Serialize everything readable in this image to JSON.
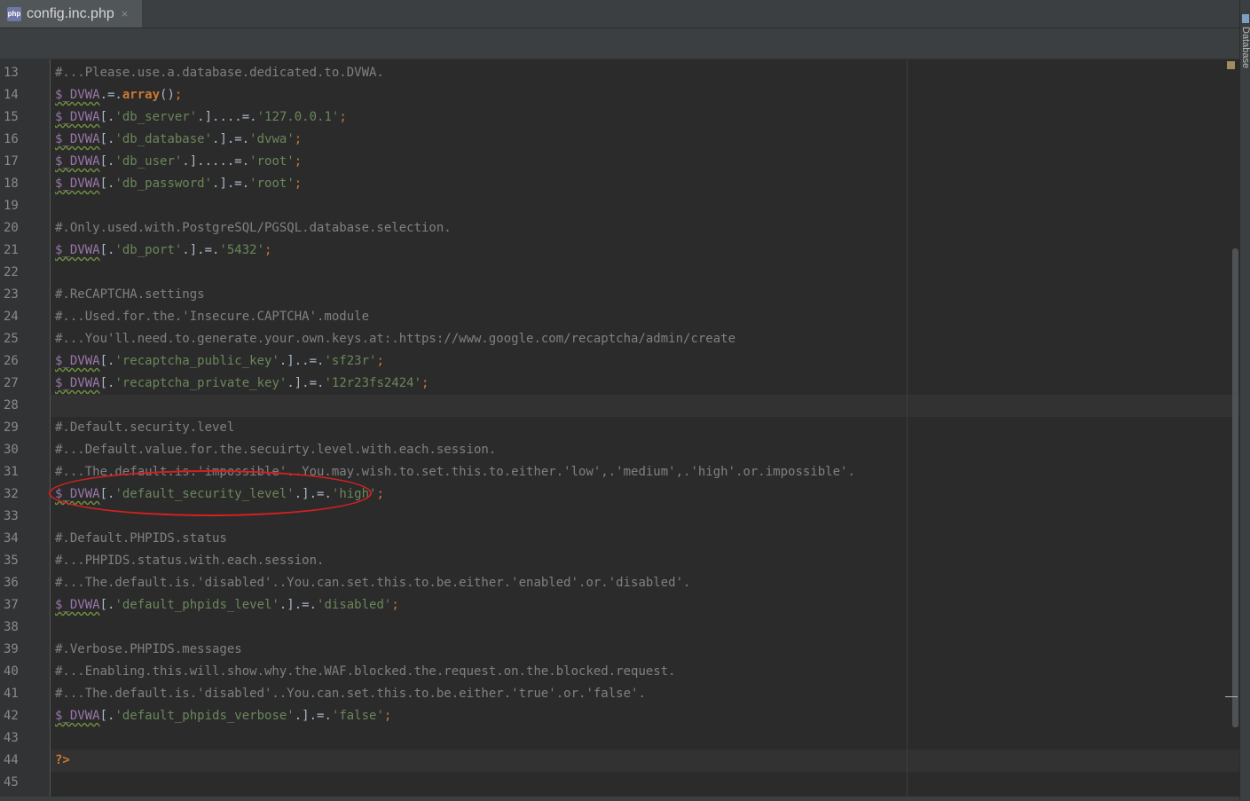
{
  "tab": {
    "icon": "php-file-icon",
    "icon_text": "php",
    "label": "config.inc.php",
    "close": "×"
  },
  "side_panel": {
    "label": "Database"
  },
  "colors": {
    "comment": "#808080",
    "variable": "#9876aa",
    "string": "#6a8759",
    "keyword": "#cc7832",
    "text": "#a9b7c6",
    "annotation": "#d42020"
  },
  "lines": [
    {
      "n": "13",
      "tokens": [
        {
          "t": "#...Please.use.a.database.dedicated.to.DVWA.",
          "c": "comment"
        }
      ]
    },
    {
      "n": "14",
      "tokens": [
        {
          "t": "$_DVWA",
          "c": "var"
        },
        {
          "t": ".=.",
          "c": "plain"
        },
        {
          "t": "array",
          "c": "kw"
        },
        {
          "t": "()",
          "c": "plain"
        },
        {
          "t": ";",
          "c": "punc"
        }
      ]
    },
    {
      "n": "15",
      "tokens": [
        {
          "t": "$_DVWA",
          "c": "var"
        },
        {
          "t": "[.",
          "c": "plain"
        },
        {
          "t": "'db_server'",
          "c": "str"
        },
        {
          "t": ".]....=.",
          "c": "plain"
        },
        {
          "t": "'127.0.0.1'",
          "c": "str"
        },
        {
          "t": ";",
          "c": "punc"
        }
      ]
    },
    {
      "n": "16",
      "tokens": [
        {
          "t": "$_DVWA",
          "c": "var"
        },
        {
          "t": "[.",
          "c": "plain"
        },
        {
          "t": "'db_database'",
          "c": "str"
        },
        {
          "t": ".].=.",
          "c": "plain"
        },
        {
          "t": "'dvwa'",
          "c": "str"
        },
        {
          "t": ";",
          "c": "punc"
        }
      ]
    },
    {
      "n": "17",
      "tokens": [
        {
          "t": "$_DVWA",
          "c": "var"
        },
        {
          "t": "[.",
          "c": "plain"
        },
        {
          "t": "'db_user'",
          "c": "str"
        },
        {
          "t": ".].....=.",
          "c": "plain"
        },
        {
          "t": "'root'",
          "c": "str"
        },
        {
          "t": ";",
          "c": "punc"
        }
      ]
    },
    {
      "n": "18",
      "tokens": [
        {
          "t": "$_DVWA",
          "c": "var"
        },
        {
          "t": "[.",
          "c": "plain"
        },
        {
          "t": "'db_password'",
          "c": "str"
        },
        {
          "t": ".].=.",
          "c": "plain"
        },
        {
          "t": "'root'",
          "c": "str"
        },
        {
          "t": ";",
          "c": "punc"
        }
      ]
    },
    {
      "n": "19",
      "tokens": []
    },
    {
      "n": "20",
      "tokens": [
        {
          "t": "#.Only.used.with.PostgreSQL/PGSQL.database.selection.",
          "c": "comment"
        }
      ]
    },
    {
      "n": "21",
      "tokens": [
        {
          "t": "$_DVWA",
          "c": "var"
        },
        {
          "t": "[.",
          "c": "plain"
        },
        {
          "t": "'db_port'",
          "c": "str"
        },
        {
          "t": ".].=.",
          "c": "plain"
        },
        {
          "t": "'5432'",
          "c": "str"
        },
        {
          "t": ";",
          "c": "punc"
        }
      ]
    },
    {
      "n": "22",
      "tokens": []
    },
    {
      "n": "23",
      "tokens": [
        {
          "t": "#.ReCAPTCHA.settings",
          "c": "comment"
        }
      ]
    },
    {
      "n": "24",
      "tokens": [
        {
          "t": "#...Used.for.the.'Insecure.CAPTCHA'.module",
          "c": "comment"
        }
      ]
    },
    {
      "n": "25",
      "tokens": [
        {
          "t": "#...You'll.need.to.generate.your.own.keys.at:.https://www.google.com/recaptcha/admin/create",
          "c": "comment"
        }
      ]
    },
    {
      "n": "26",
      "tokens": [
        {
          "t": "$_DVWA",
          "c": "var"
        },
        {
          "t": "[.",
          "c": "plain"
        },
        {
          "t": "'recaptcha_public_key'",
          "c": "str"
        },
        {
          "t": ".]..=.",
          "c": "plain"
        },
        {
          "t": "'sf23r'",
          "c": "str"
        },
        {
          "t": ";",
          "c": "punc"
        }
      ]
    },
    {
      "n": "27",
      "tokens": [
        {
          "t": "$_DVWA",
          "c": "var"
        },
        {
          "t": "[.",
          "c": "plain"
        },
        {
          "t": "'recaptcha_private_key'",
          "c": "str"
        },
        {
          "t": ".].=.",
          "c": "plain"
        },
        {
          "t": "'12r23fs2424'",
          "c": "str"
        },
        {
          "t": ";",
          "c": "punc"
        }
      ]
    },
    {
      "n": "28",
      "tokens": [],
      "current": true
    },
    {
      "n": "29",
      "tokens": [
        {
          "t": "#.Default.security.level",
          "c": "comment"
        }
      ]
    },
    {
      "n": "30",
      "tokens": [
        {
          "t": "#...Default.value.for.the.secuirty.level.with.each.session.",
          "c": "comment"
        }
      ]
    },
    {
      "n": "31",
      "tokens": [
        {
          "t": "#...The.default.is.'impossible'..You.may.wish.to.set.this.to.either.'low',.'medium',.'high'.or.impossible'.",
          "c": "comment"
        }
      ]
    },
    {
      "n": "32",
      "tokens": [
        {
          "t": "$_DVWA",
          "c": "var"
        },
        {
          "t": "[.",
          "c": "plain"
        },
        {
          "t": "'default_security_level'",
          "c": "str"
        },
        {
          "t": ".].=.",
          "c": "plain"
        },
        {
          "t": "'high'",
          "c": "str"
        },
        {
          "t": ";",
          "c": "punc"
        }
      ]
    },
    {
      "n": "33",
      "tokens": []
    },
    {
      "n": "34",
      "tokens": [
        {
          "t": "#.Default.PHPIDS.status",
          "c": "comment"
        }
      ]
    },
    {
      "n": "35",
      "tokens": [
        {
          "t": "#...PHPIDS.status.with.each.session.",
          "c": "comment"
        }
      ]
    },
    {
      "n": "36",
      "tokens": [
        {
          "t": "#...The.default.is.'disabled'..You.can.set.this.to.be.either.'enabled'.or.'disabled'.",
          "c": "comment"
        }
      ]
    },
    {
      "n": "37",
      "tokens": [
        {
          "t": "$_DVWA",
          "c": "var"
        },
        {
          "t": "[.",
          "c": "plain"
        },
        {
          "t": "'default_phpids_level'",
          "c": "str"
        },
        {
          "t": ".].=.",
          "c": "plain"
        },
        {
          "t": "'disabled'",
          "c": "str"
        },
        {
          "t": ";",
          "c": "punc"
        }
      ]
    },
    {
      "n": "38",
      "tokens": []
    },
    {
      "n": "39",
      "tokens": [
        {
          "t": "#.Verbose.PHPIDS.messages",
          "c": "comment"
        }
      ]
    },
    {
      "n": "40",
      "tokens": [
        {
          "t": "#...Enabling.this.will.show.why.the.WAF.blocked.the.request.on.the.blocked.request.",
          "c": "comment"
        }
      ]
    },
    {
      "n": "41",
      "tokens": [
        {
          "t": "#...The.default.is.'disabled'..You.can.set.this.to.be.either.'true'.or.'false'.",
          "c": "comment"
        }
      ]
    },
    {
      "n": "42",
      "tokens": [
        {
          "t": "$_DVWA",
          "c": "var"
        },
        {
          "t": "[.",
          "c": "plain"
        },
        {
          "t": "'default_phpids_verbose'",
          "c": "str"
        },
        {
          "t": ".].=.",
          "c": "plain"
        },
        {
          "t": "'false'",
          "c": "str"
        },
        {
          "t": ";",
          "c": "punc"
        }
      ]
    },
    {
      "n": "43",
      "tokens": []
    },
    {
      "n": "44",
      "tokens": [
        {
          "t": "?>",
          "c": "tag"
        }
      ],
      "current": true
    },
    {
      "n": "45",
      "tokens": []
    }
  ]
}
